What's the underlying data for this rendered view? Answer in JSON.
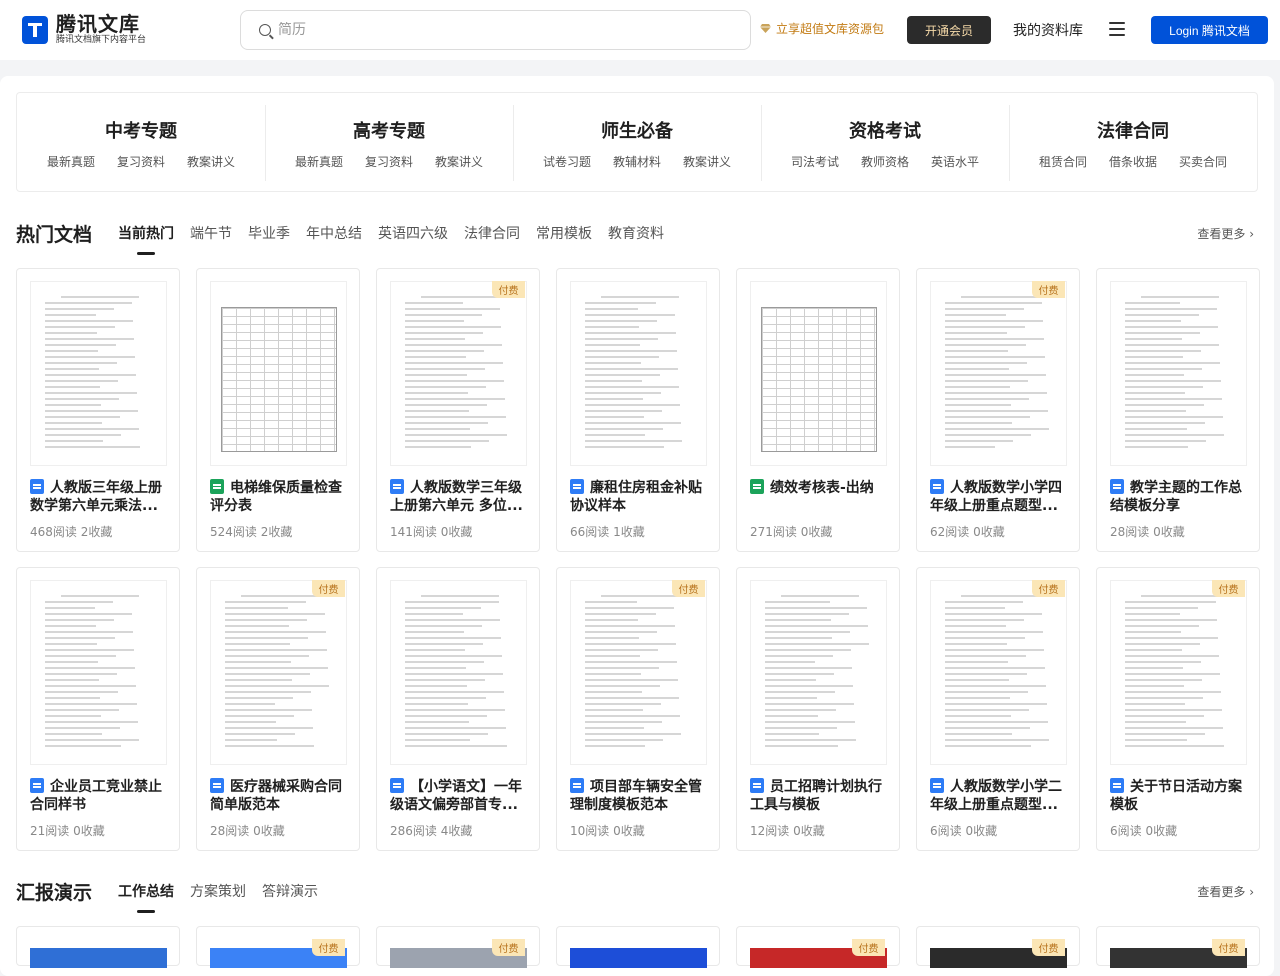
{
  "header": {
    "logo_title": "腾讯文库",
    "logo_sub": "腾讯文档旗下内容平台",
    "search_placeholder": "简历",
    "promo": "立享超值文库资源包",
    "vip": "开通会员",
    "mylib": "我的资料库",
    "login": "Login 腾讯文档"
  },
  "topics": [
    {
      "title": "中考专题",
      "links": [
        "最新真题",
        "复习资料",
        "教案讲义"
      ]
    },
    {
      "title": "高考专题",
      "links": [
        "最新真题",
        "复习资料",
        "教案讲义"
      ]
    },
    {
      "title": "师生必备",
      "links": [
        "试卷习题",
        "教辅材料",
        "教案讲义"
      ]
    },
    {
      "title": "资格考试",
      "links": [
        "司法考试",
        "教师资格",
        "英语水平"
      ]
    },
    {
      "title": "法律合同",
      "links": [
        "租赁合同",
        "借条收据",
        "买卖合同"
      ]
    }
  ],
  "hot": {
    "title": "热门文档",
    "tabs": [
      "当前热门",
      "端午节",
      "毕业季",
      "年中总结",
      "英语四六级",
      "法律合同",
      "常用模板",
      "教育资料"
    ],
    "more": "查看更多",
    "row1": [
      {
        "title": "人教版三年级上册数学第六单元乘法...",
        "meta": "468阅读 2收藏",
        "type": "doc",
        "paid": false
      },
      {
        "title": "电梯维保质量检查评分表",
        "meta": "524阅读 2收藏",
        "type": "sheet",
        "paid": false
      },
      {
        "title": "人教版数学三年级上册第六单元 多位...",
        "meta": "141阅读 0收藏",
        "type": "doc",
        "paid": true
      },
      {
        "title": "廉租住房租金补贴协议样本",
        "meta": "66阅读 1收藏",
        "type": "doc",
        "paid": false
      },
      {
        "title": "绩效考核表-出纳",
        "meta": "271阅读 0收藏",
        "type": "sheet",
        "paid": false
      },
      {
        "title": "人教版数学小学四年级上册重点题型...",
        "meta": "62阅读 0收藏",
        "type": "doc",
        "paid": true
      },
      {
        "title": "教学主题的工作总结模板分享",
        "meta": "28阅读 0收藏",
        "type": "doc",
        "paid": false
      }
    ],
    "row2": [
      {
        "title": "企业员工竞业禁止合同样书",
        "meta": "21阅读 0收藏",
        "type": "doc",
        "paid": false
      },
      {
        "title": "医疗器械采购合同简单版范本",
        "meta": "28阅读 0收藏",
        "type": "doc",
        "paid": true
      },
      {
        "title": "【小学语文】一年级语文偏旁部首专...",
        "meta": "286阅读 4收藏",
        "type": "doc",
        "paid": false
      },
      {
        "title": "项目部车辆安全管理制度模板范本",
        "meta": "10阅读 0收藏",
        "type": "doc",
        "paid": true
      },
      {
        "title": "员工招聘计划执行工具与模板",
        "meta": "12阅读 0收藏",
        "type": "doc",
        "paid": false
      },
      {
        "title": "人教版数学小学二年级上册重点题型...",
        "meta": "6阅读 0收藏",
        "type": "doc",
        "paid": true
      },
      {
        "title": "关于节日活动方案模板",
        "meta": "6阅读 0收藏",
        "type": "doc",
        "paid": true
      }
    ]
  },
  "report": {
    "title": "汇报演示",
    "tabs": [
      "工作总结",
      "方案策划",
      "答辩演示"
    ],
    "more": "查看更多",
    "row": [
      {
        "paid": false,
        "cover_color": "#2f6fd6"
      },
      {
        "paid": true,
        "cover_color": "#3b82f6"
      },
      {
        "paid": true,
        "cover_color": "#9ca3af"
      },
      {
        "paid": false,
        "cover_color": "#1d4ed8"
      },
      {
        "paid": true,
        "cover_color": "#c62828"
      },
      {
        "paid": true,
        "cover_color": "#2b2b2b"
      },
      {
        "paid": true,
        "cover_color": "#333333"
      }
    ]
  },
  "badge_label": "付费",
  "colors": {
    "brand": "#0052d9",
    "badge_bg": "#fbe6b6",
    "promo": "#c27a12"
  }
}
